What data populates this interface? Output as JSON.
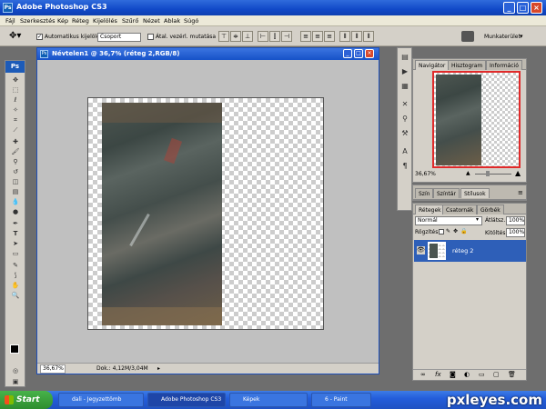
{
  "app": {
    "title": "Adobe Photoshop CS3",
    "badge": "Ps"
  },
  "menu": [
    "Fájl",
    "Szerkesztés",
    "Kép",
    "Réteg",
    "Kijelölés",
    "Szűrő",
    "Nézet",
    "Ablak",
    "Súgó"
  ],
  "options": {
    "auto_select_label": "Automatikus kijelölés:",
    "auto_select_value": "Csoport",
    "transform_label": "Átal. vezérl. mutatása",
    "workspace_label": "Munkaterület"
  },
  "document": {
    "title": "Névtelen1 @ 36,7% (réteg 2,RGB/8)",
    "zoom": "36,67%",
    "doc_info": "Dok.: 4,12M/3,04M"
  },
  "navigator": {
    "tabs": [
      "Navigátor",
      "Hisztogram",
      "Információ"
    ],
    "zoom": "36,67%"
  },
  "swatches": {
    "tabs": [
      "Szín",
      "Színtár",
      "Stílusok"
    ]
  },
  "layers": {
    "tabs": [
      "Rétegek",
      "Csatornák",
      "Görbék"
    ],
    "blend_mode": "Normál",
    "opacity_label": "Átlátsz.:",
    "opacity_value": "100%",
    "lock_label": "Rögzítés:",
    "fill_label": "Kitöltés:",
    "fill_value": "100%",
    "items": [
      {
        "name": "réteg 2",
        "selected": true
      }
    ]
  },
  "taskbar": {
    "start": "Start",
    "tasks": [
      "dali - Jegyzettömb",
      "Adobe Photoshop CS3",
      "Képek",
      "6 - Paint"
    ],
    "active_index": 1
  },
  "watermark": "pxleyes.com",
  "colors": {
    "title_blue": "#1149c8",
    "selected_layer": "#2e5fb8",
    "nav_frame": "#e02a2a"
  }
}
